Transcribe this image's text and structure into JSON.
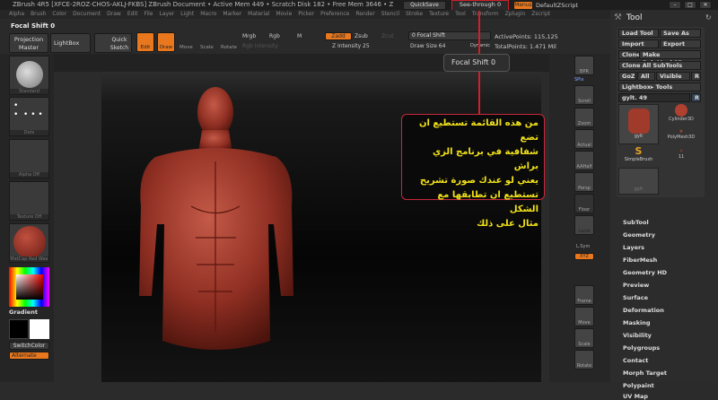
{
  "title_bar": {
    "text": "ZBrush 4R5 [XFCE-2ROZ-CHOS-AKLJ-FKBS]    ZBrush Document    • Active Mem 449 • Scratch Disk 182 • Free Mem 3646 • Z",
    "quicksave": "QuickSave",
    "see_through": "See-through  0",
    "menus": "Menus",
    "script": "DefaultZScript"
  },
  "menu": [
    "Alpha",
    "Brush",
    "Color",
    "Document",
    "Draw",
    "Edit",
    "File",
    "Layer",
    "Light",
    "Macro",
    "Marker",
    "Material",
    "Movie",
    "Picker",
    "Preference",
    "Render",
    "Stencil",
    "Stroke",
    "Texture",
    "Tool",
    "Transform",
    "Zplugin",
    "Zscript"
  ],
  "toolbar": {
    "focal_shift_label": "Focal Shift  0",
    "projection_master": "Projection Master",
    "lightbox": "LightBox",
    "quick_sketch": "Quick Sketch",
    "edit": "Edit",
    "draw": "Draw",
    "move": "Move",
    "scale": "Scale",
    "rotate": "Rotate",
    "mrgb": "Mrgb",
    "rgb": "Rgb",
    "m": "M",
    "rgb_intensity": "Rgb Intensity",
    "zadd": "Zadd",
    "zsub": "Zsub",
    "zcut": "Zcut",
    "z_intensity": "Z Intensity 25",
    "focal_shift_slider": "0 Focal Shift",
    "draw_size": "Draw Size 64",
    "dynamic": "Dynamic",
    "active_points": "ActivePoints: 115,125",
    "total_points": "TotalPoints: 1.471 Mil"
  },
  "tooltip": "Focal Shift  0",
  "left_shelf": {
    "brush": "Standard",
    "stroke": "Dots",
    "alpha": "Alpha Off",
    "texture": "Texture Off",
    "material": "MatCap Red Wax",
    "gradient": "Gradient",
    "switch_color": "SwitchColor",
    "alternate": "Alternate"
  },
  "right_shelf": [
    "BPR",
    "SPix",
    "Scroll",
    "Zoom",
    "Actual",
    "AAHalf",
    "Persp",
    "Floor",
    "Local",
    "L.Sym",
    "XYZ",
    "Frame",
    "Move",
    "Scale",
    "Rotate"
  ],
  "tool_palette": {
    "title": "Tool",
    "load_tool": "Load Tool",
    "save_as": "Save As",
    "import": "Import",
    "export": "Export",
    "clone": "Clone",
    "make_polymesh": "Make PolyMesh3D",
    "clone_all": "Clone All SubTools",
    "goz": "GoZ",
    "all": "All",
    "visible": "Visible",
    "r": "R",
    "lightbox_tools": "Lightbox▸ Tools",
    "current_tool": "gylt. 49",
    "thumbs": [
      "gylt",
      "Cylinder3D",
      "PolyMesh3D",
      "SimpleBrush",
      "11",
      "gylt"
    ],
    "sections": [
      "SubTool",
      "Geometry",
      "Layers",
      "FiberMesh",
      "Geometry HD",
      "Preview",
      "Surface",
      "Deformation",
      "Masking",
      "Visibility",
      "Polygroups",
      "Contact",
      "Morph Target",
      "Polypaint",
      "UV Map"
    ]
  },
  "callout": [
    "من هذه القائمة تستطيع ان تضع",
    "شفافية في برنامج الزي براش",
    "يعني لو عندك صورة تشريح",
    "تستطيع ان تطابقها مع الشكل",
    "مثال على ذلك"
  ],
  "colors": {
    "accent": "#e8771d",
    "callout_border": "#c8283a",
    "callout_text": "#f2e21a"
  }
}
